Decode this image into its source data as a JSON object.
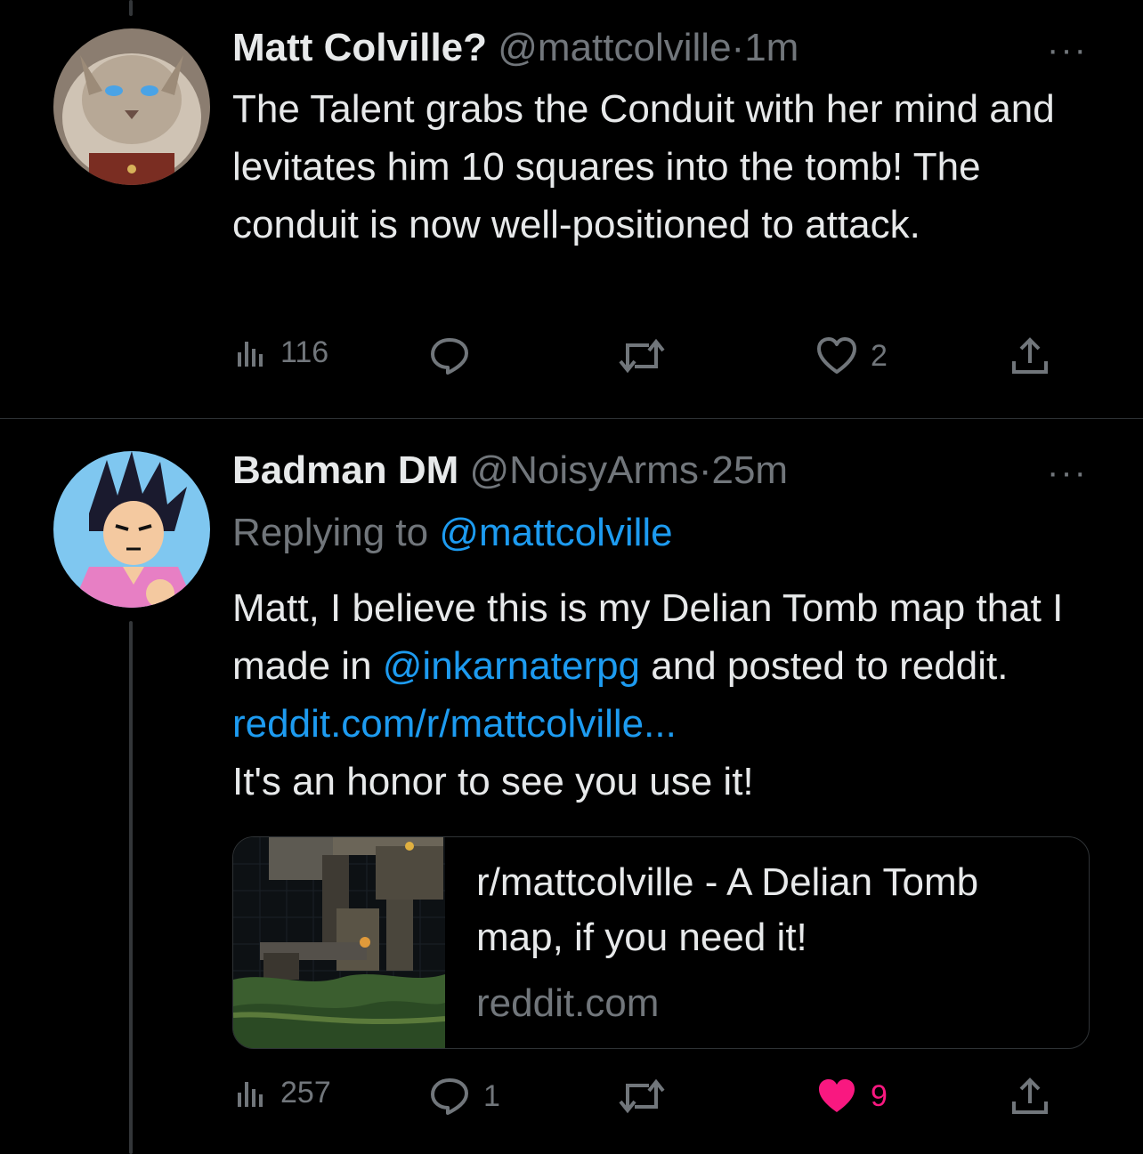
{
  "tweets": [
    {
      "name": "Matt Colville?",
      "handle": "@mattcolville",
      "separator": "·",
      "time": "1m",
      "more": "···",
      "text": "The Talent grabs the Conduit with her mind and levitates him 10 squares into the tomb! The conduit is now well-positioned to attack.",
      "stats": {
        "views": "116",
        "replies": "",
        "retweets": "",
        "likes": "2"
      }
    },
    {
      "name": "Badman DM",
      "handle": "@NoisyArms",
      "separator": "·",
      "time": "25m",
      "more": "···",
      "replying_prefix": "Replying to ",
      "replying_to": "@mattcolville",
      "text_part1": "Matt, I believe this is my Delian Tomb map that I made in ",
      "mention": "@inkarnaterpg",
      "text_part2": " and posted to reddit. ",
      "url": "reddit.com/r/mattcolville...",
      "text_part3": "It's an honor to see you use it!",
      "card": {
        "title": "r/mattcolville - A Delian Tomb map, if you need it!",
        "domain": "reddit.com"
      },
      "stats": {
        "views": "257",
        "replies": "1",
        "retweets": "",
        "likes": "9"
      }
    }
  ],
  "colors": {
    "background": "#000000",
    "text": "#e7e9ea",
    "muted": "#71767b",
    "link": "#1d9bf0",
    "like_active": "#f91880"
  }
}
